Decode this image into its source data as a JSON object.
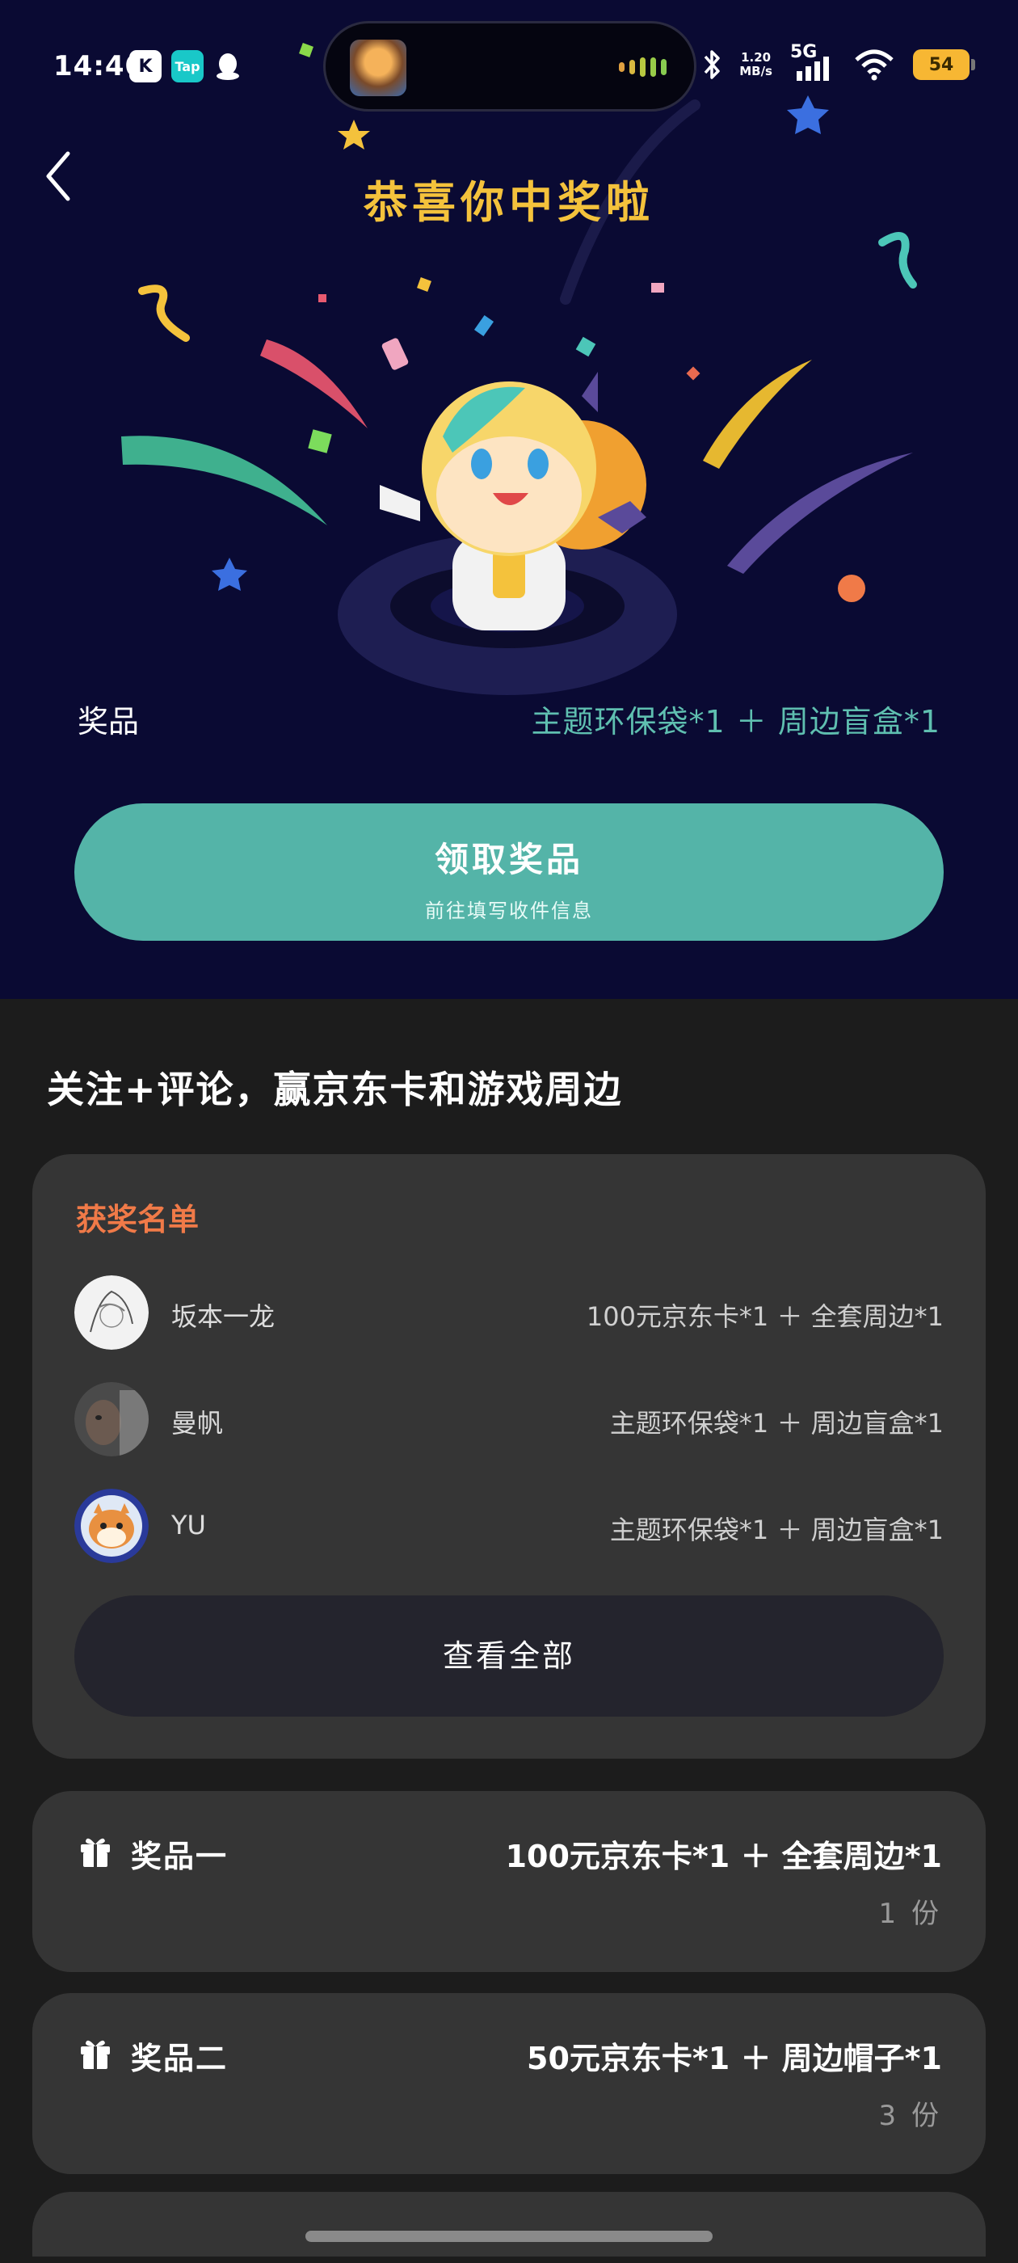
{
  "status_bar": {
    "time": "14:40",
    "apps": [
      "K",
      "Tap"
    ],
    "net_speed_value": "1.20",
    "net_speed_unit": "MB/s",
    "network": "5G",
    "battery": "54"
  },
  "header": {
    "title": "恭喜你中奖啦"
  },
  "prize": {
    "label": "奖品",
    "value": "主题环保袋*1 ＋ 周边盲盒*1"
  },
  "claim_button": {
    "label": "领取奖品",
    "sublabel": "前往填写收件信息"
  },
  "section": {
    "title": "关注+评论，赢京东卡和游戏周边"
  },
  "winners": {
    "heading": "获奖名单",
    "list": [
      {
        "name": "坂本一龙",
        "prize": "100元京东卡*1 ＋ 全套周边*1"
      },
      {
        "name": "曼帆",
        "prize": "主题环保袋*1 ＋ 周边盲盒*1"
      },
      {
        "name": "YU",
        "prize": "主题环保袋*1 ＋ 周边盲盒*1"
      }
    ],
    "view_all": "查看全部"
  },
  "prizes": [
    {
      "title": "奖品一",
      "value": "100元京东卡*1 ＋ 全套周边*1",
      "count": "1 份"
    },
    {
      "title": "奖品二",
      "value": "50元京东卡*1 ＋ 周边帽子*1",
      "count": "3 份"
    }
  ],
  "colors": {
    "hero_bg": "#0a0a33",
    "title_gold": "#f4c23c",
    "accent_teal": "#54b4a8",
    "prize_text": "#5fbfb0",
    "winners_heading": "#f07a48",
    "card_bg": "#353535",
    "page_bg": "#1c1c1c"
  }
}
